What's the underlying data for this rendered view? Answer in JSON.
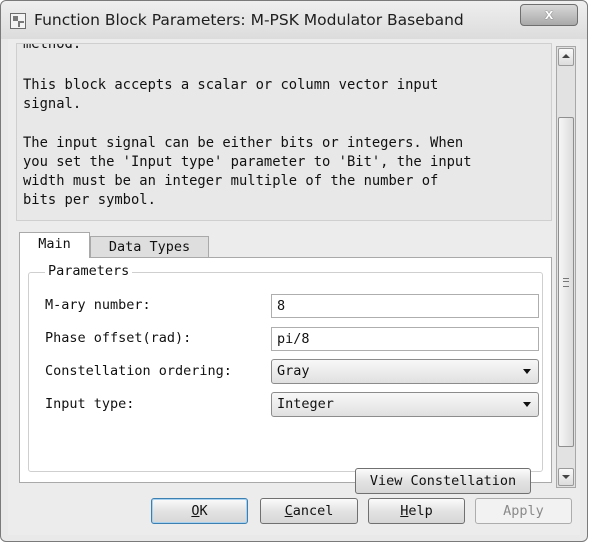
{
  "window": {
    "title": "Function Block Parameters: M-PSK Modulator Baseband",
    "close_label": "x"
  },
  "description": {
    "cut_line": "method.",
    "para1": "This block accepts a scalar or column vector input\nsignal.",
    "para2": "The input signal can be either bits or integers. When\nyou set the 'Input type' parameter to 'Bit', the input\nwidth must be an integer multiple of the number of\nbits per symbol."
  },
  "tabs": [
    {
      "label": "Main",
      "active": true
    },
    {
      "label": "Data Types",
      "active": false
    }
  ],
  "parameters": {
    "legend": "Parameters",
    "mary_label": "M-ary number:",
    "mary_value": "8",
    "phase_label": "Phase offset(rad):",
    "phase_value": "pi/8",
    "ordering_label": "Constellation ordering:",
    "ordering_value": "Gray",
    "input_type_label": "Input type:",
    "input_type_value": "Integer",
    "view_button": "View Constellation"
  },
  "buttons": {
    "ok_first": "O",
    "ok_rest": "K",
    "cancel_first": "C",
    "cancel_rest": "ancel",
    "help_first": "H",
    "help_rest": "elp",
    "apply": "Apply"
  },
  "colors": {
    "background": "#ececec",
    "apply_disabled_text": "#8a8a8a"
  },
  "icons": {
    "app": "window-parameters-icon",
    "close": "close-icon",
    "dropdown": "chevron-down-icon"
  }
}
